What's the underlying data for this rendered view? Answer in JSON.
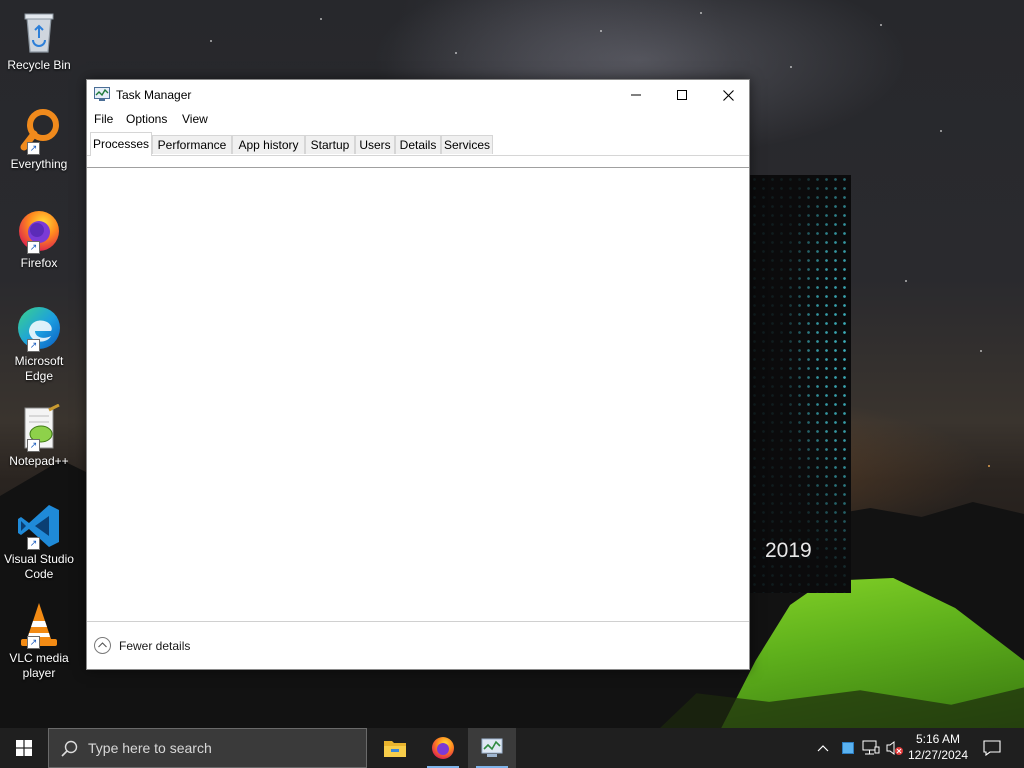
{
  "desktop": {
    "wallpaper_year": "2019",
    "icons": [
      {
        "label": "Recycle Bin",
        "icon": "recycle-bin-icon"
      },
      {
        "label": "Everything",
        "icon": "everything-search-icon"
      },
      {
        "label": "Firefox",
        "icon": "firefox-icon"
      },
      {
        "label": "Microsoft Edge",
        "icon": "edge-icon"
      },
      {
        "label": "Notepad++",
        "icon": "notepad-plus-plus-icon"
      },
      {
        "label": "Visual Studio Code",
        "icon": "vscode-icon"
      },
      {
        "label": "VLC media player",
        "icon": "vlc-icon"
      }
    ]
  },
  "window": {
    "title": "Task Manager",
    "menu": [
      "File",
      "Options",
      "View"
    ],
    "tabs": [
      {
        "label": "Processes",
        "active": true
      },
      {
        "label": "Performance",
        "active": false
      },
      {
        "label": "App history",
        "active": false
      },
      {
        "label": "Startup",
        "active": false
      },
      {
        "label": "Users",
        "active": false
      },
      {
        "label": "Details",
        "active": false
      },
      {
        "label": "Services",
        "active": false
      }
    ],
    "footer": {
      "fewer_details_label": "Fewer details"
    }
  },
  "taskbar": {
    "search_placeholder": "Type here to search",
    "apps": [
      {
        "name": "File Explorer",
        "icon": "file-explorer-icon",
        "active": false
      },
      {
        "name": "Firefox",
        "icon": "firefox-icon",
        "active": false
      },
      {
        "name": "Task Manager",
        "icon": "task-manager-icon",
        "active": true
      }
    ],
    "clock": {
      "time": "5:16 AM",
      "date": "12/27/2024"
    }
  },
  "colors": {
    "taskbar_bg": "#1f1f1f",
    "active_indicator": "#7fb4ea",
    "banner_dots": "#46d2e1",
    "tent_green": "#7ad226"
  }
}
